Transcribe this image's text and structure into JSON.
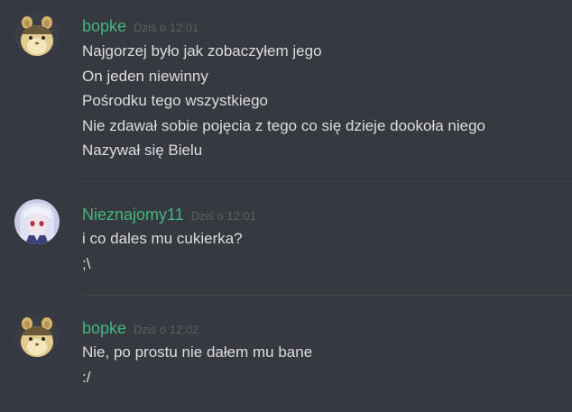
{
  "messages": [
    {
      "username": "bopke",
      "timestamp": "Dziś o 12:01",
      "avatar": "hamster-avatar",
      "lines": [
        "Najgorzej było jak zobaczyłem jego",
        "On jeden niewinny",
        "Pośrodku tego wszystkiego",
        "Nie zdawał sobie pojęcia z tego co się dzieje dookoła niego",
        "Nazywał się Bielu"
      ]
    },
    {
      "username": "Nieznajomy11",
      "timestamp": "Dziś o 12:01",
      "avatar": "anime-girl-avatar",
      "lines": [
        "i co dales mu cukierka?",
        ";\\"
      ]
    },
    {
      "username": "bopke",
      "timestamp": "Dziś o 12:02",
      "avatar": "hamster-avatar",
      "lines": [
        "Nie, po prostu nie dałem mu bane",
        ":/"
      ]
    }
  ],
  "colors": {
    "background": "#36393f",
    "username": "#43b581",
    "message_text": "#dcddde",
    "timestamp": "#5c5f64",
    "divider": "#42454a"
  }
}
